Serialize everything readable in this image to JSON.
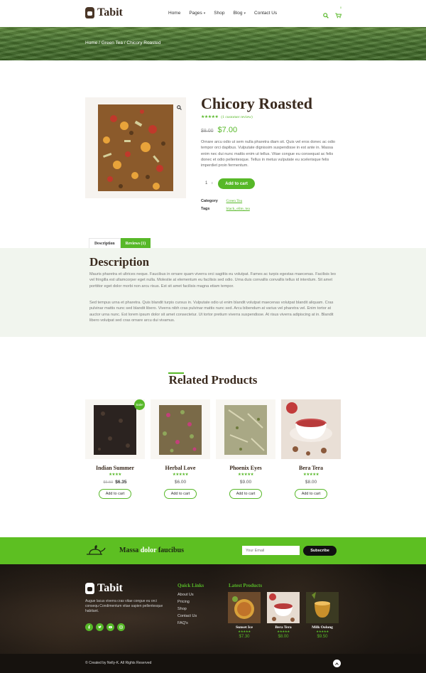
{
  "header": {
    "brand": "Tabit",
    "nav": [
      {
        "label": "Home"
      },
      {
        "label": "Pages",
        "dropdown": true
      },
      {
        "label": "Shop"
      },
      {
        "label": "Blog",
        "dropdown": true
      },
      {
        "label": "Contact Us"
      }
    ],
    "cart_count": "0"
  },
  "breadcrumb": "Home / Green Tea / Chicory Roasted",
  "product": {
    "title": "Chicory Roasted",
    "rating_stars": "★★★★★",
    "review_link": "(1 customer review)",
    "old_price": "$8.00",
    "price": "$7.00",
    "description": "Ornare arcu odio ut sem nulla pharetra diam sit. Quis vel eros donec ac odio tempor orci dapibus. Vulputate dignissim suspendisse in est ante in. Massa enim nec dui nunc mattis enim ut tellus. Vitae congue eu consequat ac felis donec et odio pellentesque. Tellus in metus vulputate eu scelerisque felis imperdiet proin fermentum.",
    "quantity": "1",
    "add_to_cart": "Add to cart",
    "category_label": "Category",
    "category_value": "Green Tea",
    "tags_label": "Tags",
    "tags_value": "black, elite, tea"
  },
  "tabs": [
    {
      "label": "Description"
    },
    {
      "label": "Reviews (1)"
    }
  ],
  "description_section": {
    "title": "Description",
    "paragraph1": "Mauris pharetra et ultrices neque. Faucibus in ornare quam viverra orci sagittis eu volutpat. Fames ac turpis egestas maecenas. Facilisis leo vel fringilla est ullamcorper eget nulla. Molestie at elementum eu facilisis sed odio. Urna duis convallis convallis tellus id interdum. Sit amet porttitor eget dolor morbi non arcu risus. Est sit amet facilisis magna etiam tempor.",
    "paragraph2": "Sed tempus urna et pharetra. Quis blandit turpis cursus in. Vulputate odio ut enim blandit volutpat maecenas volutpat blandit aliquam. Cras pulvinar mattis nunc sed blandit libero. Viverra nibh cras pulvinar mattis nunc sed. Arcu bibendum at varius vel pharetra vel. Enim tortor at auctor urna nunc. Est lorem ipsum dolor sit amet consectetur. Ut tortor pretium viverra suspendisse. At risus viverra adipiscing at in. Blandit libero volutpat sed cras ornare arcu dui vivamus."
  },
  "related": {
    "title": "Related Products",
    "items": [
      {
        "name": "Indian Summer",
        "stars": "★★★★",
        "old_price": "$6.50",
        "price": "$6.35",
        "sale": "Sale!",
        "button": "Add to cart"
      },
      {
        "name": "Herbal Love",
        "stars": "★★★★★",
        "price": "$6.00",
        "button": "Add to cart"
      },
      {
        "name": "Phoenix Eyes",
        "stars": "★★★★★",
        "price": "$9.00",
        "button": "Add to cart"
      },
      {
        "name": "Bera Tera",
        "stars": "★★★★★",
        "price": "$8.00",
        "button": "Add to cart"
      }
    ]
  },
  "newsletter": {
    "text_pre": "Massa",
    "text_highlight": "dolor",
    "text_post": "faucibus",
    "placeholder": "Your Email",
    "button": "Subscribe"
  },
  "footer": {
    "brand": "Tabit",
    "about": "Augue lacus viverra cras vitae congue eu orci consequ Condimentum vitae sapien pellentesque habitant.",
    "quick_links_title": "Quick Links",
    "quick_links": [
      "About Us",
      "Pricing",
      "Shop",
      "Contact Us",
      "FAQ's"
    ],
    "latest_title": "Latest Products",
    "latest": [
      {
        "name": "Sunset Ice",
        "stars": "★★★★★",
        "price": "$7.30"
      },
      {
        "name": "Bera Tera",
        "stars": "★★★★★",
        "price": "$8.00"
      },
      {
        "name": "Milk Oolong",
        "stars": "★★★★★",
        "price": "$9.50"
      }
    ],
    "copyright": "© Created by Nelly-K. All Rights Reserved"
  },
  "colors": {
    "accent": "#57b828",
    "dark": "#3a2a1e",
    "footer_bg": "#231c16"
  }
}
